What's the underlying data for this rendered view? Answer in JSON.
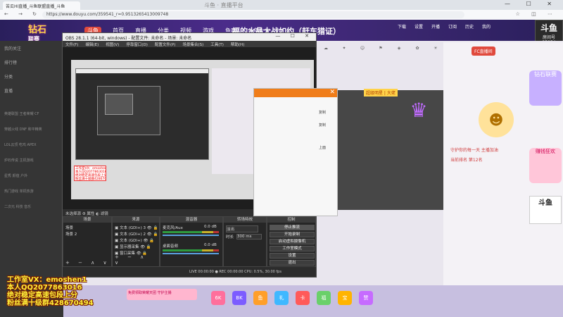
{
  "browser": {
    "tab_title": "苦瓜HI直播_斗鱼联盟直播_斗鱼",
    "window_title": "斗鱼 · 直播平台",
    "address": "https://www.douyu.com/359541_r=0.9513265413009748",
    "nav_icons": "← → ↻",
    "right_icons": "☆ ◫ ⋯",
    "window_controls": "— ☐ ✕"
  },
  "site": {
    "logo_main": "钻石",
    "logo_sub": "联赛",
    "nav": [
      {
        "label": "斗鱼",
        "brand": true
      },
      {
        "label": "首页"
      },
      {
        "label": "直播"
      },
      {
        "label": "分类"
      },
      {
        "label": "视频"
      },
      {
        "label": "游戏"
      },
      {
        "label": "鱼吧"
      },
      {
        "label": "斗鱼十少"
      }
    ],
    "room_title": "福的水晶大战如约（赶车猎证）",
    "header_icons": [
      "下载",
      "设置",
      "开播",
      "订阅",
      "历史",
      "我的"
    ],
    "corner_badge_title": "斗鱼",
    "corner_badge_sub": "房间号",
    "corner_badge_id": "35954"
  },
  "sidebar": {
    "items": [
      "我的关注",
      "排行榜",
      "分类",
      "直播"
    ],
    "grid_rows": [
      "英雄联盟  王者荣耀  CF",
      "穿越火线  DNF  和平精英",
      "LOL云顶  吃鸡  APEX",
      "炉石传说  主机游戏",
      "星秀  颜值  户外",
      "热门游戏  单机热游",
      "二次元  科技  音乐"
    ]
  },
  "stream": {
    "tag": "超级明星 | 大佬",
    "emblem": "♛",
    "gift_icons": [
      "☁",
      "✦",
      "☺",
      "⚑",
      "◈",
      "✿",
      "☀",
      "❖",
      "◎"
    ],
    "banner_top": "FC直播间",
    "mascot": "☻",
    "chat": [
      "守护你的每一天 主播加油",
      "当前排名 第12名"
    ],
    "promo_a": "钻石联赛",
    "promo_b": "赚钱狂欢",
    "promo_c": "斗鱼",
    "bottom_icons": [
      "6K",
      "BK",
      "鱼",
      "礼",
      "卡",
      "福",
      "宝",
      "赞"
    ],
    "pink_note": "免费领取荣耀天团 守护主播"
  },
  "obs": {
    "title": "OBS 28.1.1 (64-bit, windows) - 配置文件: 未命名 - 场景: 未命名",
    "window_controls": "— ☐ ✕",
    "menu": [
      "文件(F)",
      "编辑(E)",
      "视图(V)",
      "停靠窗口(D)",
      "配置文件(P)",
      "场景集合(S)",
      "工具(T)",
      "帮助(H)"
    ],
    "inner_red_note": [
      "工作室VX：emoshen1",
      "本人QQ2077863016",
      "绝对稳定高速包段上分",
      "粉丝满十级群428670494"
    ],
    "orange_panel_labels": [
      "复制",
      "复制",
      "上面"
    ],
    "status_strip": "未选择源    ⚙ 属性    ◐ 滤镜",
    "docks": {
      "scenes_title": "场景",
      "scenes": [
        "场景",
        "场景 2"
      ],
      "sources_title": "来源",
      "sources": [
        "文本 (GDI+) 3",
        "文本 (GDI+) 2",
        "文本 (GDI+)",
        "显示器采集",
        "窗口采集"
      ],
      "mixer_title": "混音器",
      "mixer": [
        {
          "name": "麦克风/Aux",
          "db": "0.0 dB"
        },
        {
          "name": "桌面音频",
          "db": "0.0 dB"
        }
      ],
      "transitions_title": "转场特效",
      "transition_type": "淡出",
      "duration_label": "时长",
      "duration_value": "300 ms",
      "controls_title": "控制",
      "controls": [
        "停止推流",
        "开始录制",
        "启动虚拟摄像机",
        "工作室模式",
        "设置",
        "退出"
      ],
      "dock_foot": "+ − ∧ ∨"
    },
    "bottom_status": "LIVE 00:00:00  ● REC 00:00:00  CPU: 0.5%, 30.00 fps"
  },
  "watermark": {
    "lines": [
      "工作室VX：emoshen1",
      "本人QQ2077863016",
      "绝对稳定高速包段上分",
      "粉丝满十级群428670494"
    ]
  }
}
